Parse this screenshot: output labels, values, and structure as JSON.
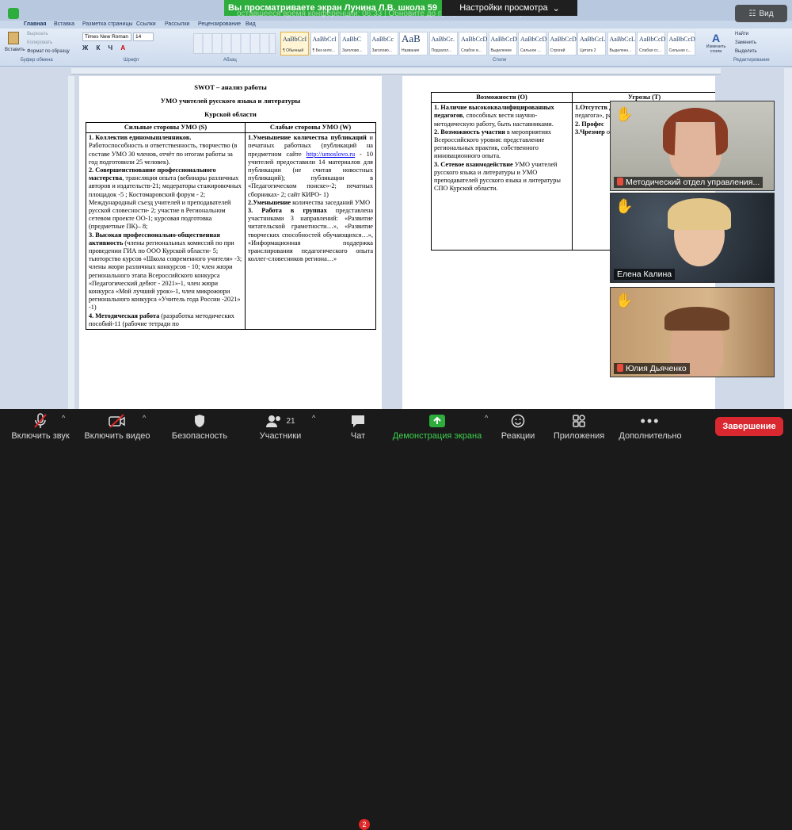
{
  "zoom": {
    "share_banner": "Вы просматриваете экран Лунина Л.В. школа 59",
    "view_options": "Настройки просмотра",
    "marquee": "оставшееся время конференции: 06:33 | Обновите до профессиональной версии",
    "view_button": "Вид",
    "participants": [
      {
        "name": "Методический отдел управления...",
        "muted": true,
        "hand": true
      },
      {
        "name": "Елена Калина",
        "muted": false,
        "hand": true
      },
      {
        "name": "Юлия Дьяченко",
        "muted": true,
        "hand": true
      }
    ],
    "toolbar": {
      "audio": "Включить звук",
      "video": "Включить видео",
      "security": "Безопасность",
      "participants": "Участники",
      "participants_count": "21",
      "chat": "Чат",
      "chat_badge": "2",
      "share": "Демонстрация экрана",
      "reactions": "Реакции",
      "apps": "Приложения",
      "more": "Дополнительно",
      "end": "Завершение"
    },
    "colors": {
      "green": "#2dad3c",
      "end_red": "#d9282f",
      "hand": "#f0c42c"
    }
  },
  "word": {
    "tabs": [
      "Главная",
      "Вставка",
      "Разметка страницы",
      "Ссылки",
      "Рассылки",
      "Рецензирование",
      "Вид"
    ],
    "clipboard": {
      "paste": "Вставить",
      "cut": "Вырезать",
      "copy": "Копировать",
      "format": "Формат по образцу",
      "label": "Буфер обмена"
    },
    "font": {
      "name": "Times New Roman",
      "size": "14",
      "label": "Шрифт"
    },
    "paragraph_label": "Абзац",
    "styles_label": "Стили",
    "editing_label": "Редактирование",
    "styles": [
      {
        "sample": "AaBbCcI",
        "name": "¶ Обычный"
      },
      {
        "sample": "AaBbCcI",
        "name": "¶ Без инте..."
      },
      {
        "sample": "AaBbC",
        "name": "Заголово..."
      },
      {
        "sample": "AaBbCc",
        "name": "Заголово..."
      },
      {
        "sample": "AaB",
        "name": "Название"
      },
      {
        "sample": "AaBbCc.",
        "name": "Подзагол..."
      },
      {
        "sample": "AaBbCcD",
        "name": "Слабое в..."
      },
      {
        "sample": "AaBbCcD",
        "name": "Выделение"
      },
      {
        "sample": "AaBbCcD",
        "name": "Сильное ..."
      },
      {
        "sample": "AaBbCcD",
        "name": "Строгий"
      },
      {
        "sample": "AaBbCcL",
        "name": "Цитата 2"
      },
      {
        "sample": "AaBbCcL",
        "name": "Выделенн..."
      },
      {
        "sample": "AaBbCcD",
        "name": "Слабая сс..."
      },
      {
        "sample": "AaBbCcD",
        "name": "Сильная с..."
      }
    ],
    "change_styles": "Изменить стили",
    "editing": {
      "find": "Найти",
      "replace": "Заменить",
      "select": "Выделить"
    }
  },
  "doc": {
    "title": "SWOT – анализ работы",
    "subtitle": "УМО  учителей русского языка и литературы",
    "region": "Курской области",
    "col_s": "Сильные стороны УМО (S)",
    "col_w": "Слабые стороны УМО (W)",
    "strengths": [
      {
        "b": "1. Коллектив единомышленников.",
        "t": " Работоспособность и ответственность, творчество (в составе УМО 30 членов,  отчёт по итогам работы за год подготовили  25 человек)."
      },
      {
        "b": "2. Совершенствование профессионального мастерства",
        "t": ", трансляция опыта (вебинары различных авторов и издательств-21; модераторы стажировочных площадок -5 ; Костомаровский форум - 2; Международный съезд учителей и преподавателей русской словесности- 2; участие в Региональном сетевом проекте ОО-1; курсовая подготовка (предметные ПК)– 8;"
      },
      {
        "b": "3. Высокая профессионально-общественная активность",
        "t": " (члены региональных  комиссий по при проведении ГИА по ООО Курской области- 5;  тьюторство курсов «Школа современного учителя» -3; члены жюри различных конкурсов - 10; член жюри регионального этапа Всероссийского конкурса «Педагогический дебют - 2021»-1, член жюри конкурса «Мой лучший урок»-1, член микрожюри регионального конкурса «Учитель года России -2021» -1)"
      },
      {
        "b": "4. Методическая работа",
        "t": " (разработка методических пособий-11 (рабочие тетради по"
      }
    ],
    "weaknesses": [
      {
        "b": "1.Уменьшение  количества публикаций",
        "t": "  и печатных работных (публикаций  на предметном сайте "
      },
      {
        "b": "",
        "t": "http://umoslovo.ru"
      },
      {
        "b": "",
        "t": " - 10  учителей предоставили  14 материалов для публикации (не считая новостных публикаций);  публикации в «Педагогическом поиске»-2; печатных сборниках- 2;  сайт КИРО- 1)"
      },
      {
        "b": "2.Уменьшение",
        "t": " количества заседаний УМО"
      },
      {
        "b": "3.  Работа  в  группах",
        "t": " представлена участниками 3 направлений: «Развитие читательской грамотности…», «Развитие творческих способностей обучающихся…», «Информационная поддержка транслирования педагогического опыта коллег-словесников региона…»"
      }
    ],
    "col_o": "Возможности (O)",
    "col_t": "Угрозы (T)",
    "opportunities": [
      {
        "b": "1. Наличие высококвалифицированных педагогов",
        "t": ", способных вести научно-методическую работу, быть наставниками."
      },
      {
        "b": "2. Возможность участия",
        "t": " в мероприятиях Всероссийского уровня: представление региональных практик, собственного инновационного опыта."
      },
      {
        "b": "3. Сетевое взаимодействие",
        "t": " УМО учителей русского языка и литературы и УМО преподавателей русского языка и литературы СПО Курской области."
      }
    ],
    "threats_partial": [
      {
        "b": "1.Отсутств деятельно",
        "t": "«Наставни профессио педагога», разными к"
      },
      {
        "b": "2. Профес",
        "t": ""
      },
      {
        "b": "3.Чрезмер",
        "t": " основном снижения"
      }
    ]
  }
}
